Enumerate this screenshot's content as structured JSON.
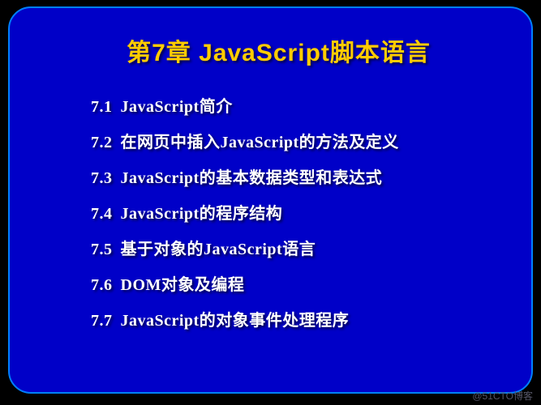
{
  "title": "第7章  JavaScript脚本语言",
  "toc": [
    {
      "num": "7.1",
      "text": "JavaScript简介"
    },
    {
      "num": "7.2",
      "text": "在网页中插入JavaScript的方法及定义"
    },
    {
      "num": "7.3",
      "text": "JavaScript的基本数据类型和表达式"
    },
    {
      "num": "7.4",
      "text": "JavaScript的程序结构"
    },
    {
      "num": "7.5",
      "text": "基于对象的JavaScript语言"
    },
    {
      "num": "7.6",
      "text": "DOM对象及编程"
    },
    {
      "num": "7.7",
      "text": "JavaScript的对象事件处理程序"
    }
  ],
  "watermark": "@51CTO博客"
}
